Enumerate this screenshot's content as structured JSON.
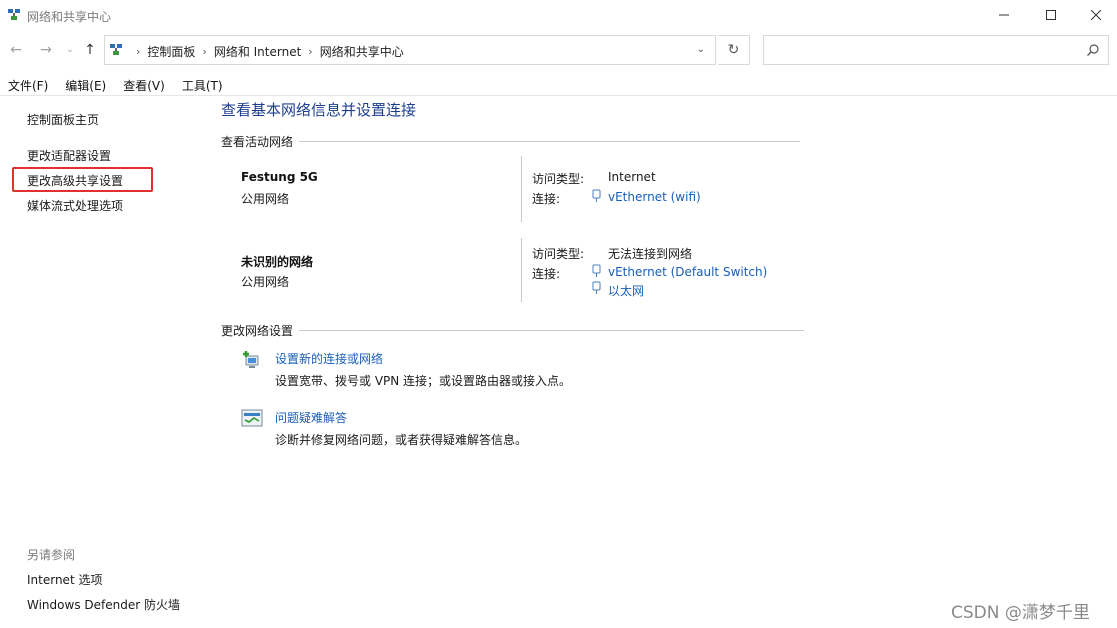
{
  "window": {
    "title": "网络和共享中心"
  },
  "address_bar": {
    "crumbs": [
      "控制面板",
      "网络和 Internet",
      "网络和共享中心"
    ],
    "search_placeholder": ""
  },
  "menu": [
    "文件(F)",
    "编辑(E)",
    "查看(V)",
    "工具(T)"
  ],
  "left_pane": {
    "home": "控制面板主页",
    "links": [
      "更改适配器设置",
      "更改高级共享设置",
      "媒体流式处理选项"
    ],
    "see_also_title": "另请参阅",
    "see_also": [
      "Internet 选项",
      "Windows Defender 防火墙"
    ]
  },
  "main": {
    "title": "查看基本网络信息并设置连接",
    "active_networks_heading": "查看活动网络",
    "networks": [
      {
        "name": "Festung 5G",
        "type": "公用网络",
        "access_label": "访问类型:",
        "access_value": "Internet",
        "conn_label": "连接:",
        "connections": [
          "vEthernet (wifi)"
        ]
      },
      {
        "name": "未识别的网络",
        "type": "公用网络",
        "access_label": "访问类型:",
        "access_value": "无法连接到网络",
        "conn_label": "连接:",
        "connections": [
          "vEthernet (Default Switch)",
          "以太网"
        ]
      }
    ],
    "change_heading": "更改网络设置",
    "tasks": [
      {
        "link": "设置新的连接或网络",
        "desc": "设置宽带、拨号或 VPN 连接；或设置路由器或接入点。"
      },
      {
        "link": "问题疑难解答",
        "desc": "诊断并修复网络问题，或者获得疑难解答信息。"
      }
    ]
  },
  "watermark": "CSDN @潇梦千里",
  "colors": {
    "link": "#1a5fb4",
    "title": "#1e3f8e",
    "highlight": "#e03030"
  }
}
